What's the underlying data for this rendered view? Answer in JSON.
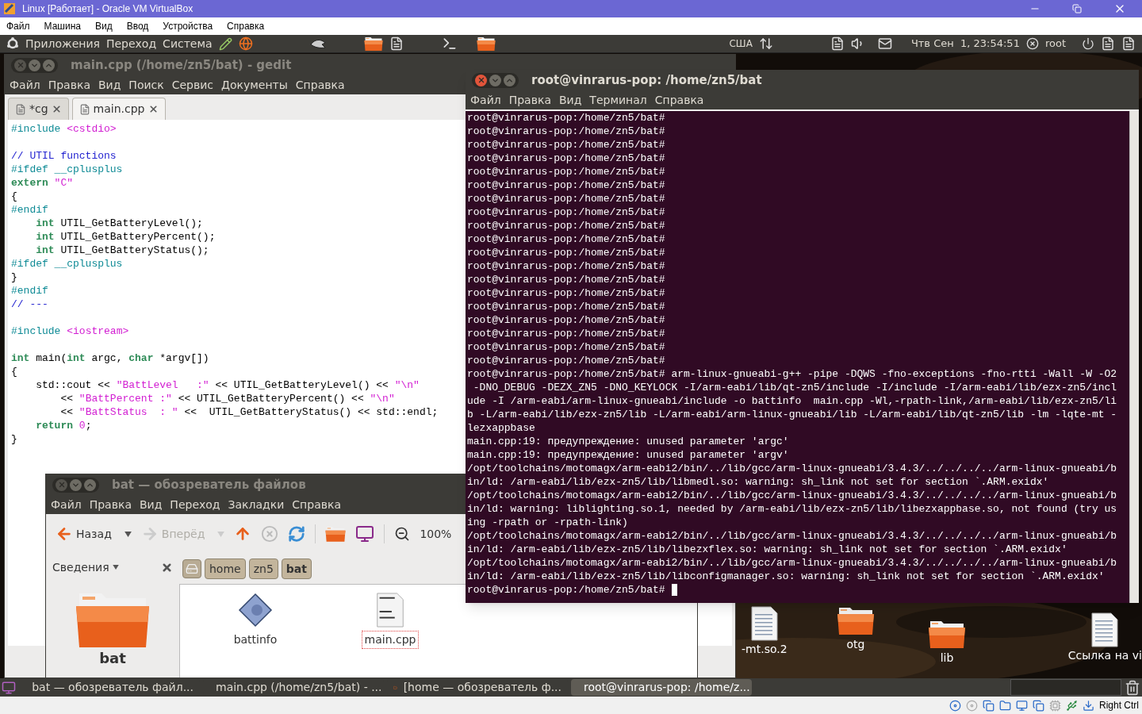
{
  "vbox": {
    "title": "Linux [Работает] - Oracle VM VirtualBox",
    "menu": [
      "Файл",
      "Машина",
      "Вид",
      "Ввод",
      "Устройства",
      "Справка"
    ],
    "host_key": "Right Ctrl"
  },
  "top_panel": {
    "menus": [
      "Приложения",
      "Переход",
      "Система"
    ],
    "keyboard": "США",
    "clock": "Чтв Сен  1, 23:54:51",
    "user": "root"
  },
  "gedit": {
    "title": "main.cpp (/home/zn5/bat) - gedit",
    "menu": [
      "Файл",
      "Правка",
      "Вид",
      "Поиск",
      "Сервис",
      "Документы",
      "Справка"
    ],
    "tabs": [
      {
        "label": "*cg",
        "selected": false
      },
      {
        "label": "main.cpp",
        "selected": true
      }
    ],
    "lines": [
      {
        "kind": "code",
        "segments": [
          {
            "kind": "preproc",
            "text": "#include"
          },
          {
            "kind": "string",
            "text": " <cstdio>"
          }
        ]
      },
      {
        "kind": "blank"
      },
      {
        "kind": "code",
        "segments": [
          {
            "kind": "comment",
            "text": "// UTIL functions"
          }
        ]
      },
      {
        "kind": "code",
        "segments": [
          {
            "kind": "preproc",
            "text": "#ifdef __cplusplus"
          }
        ]
      },
      {
        "kind": "code",
        "segments": [
          {
            "kind": "keyword",
            "text": "extern"
          },
          {
            "kind": "string",
            "text": " \"C\""
          }
        ]
      },
      {
        "kind": "code",
        "segments": [
          {
            "kind": "plain",
            "text": "{"
          }
        ]
      },
      {
        "kind": "code",
        "segments": [
          {
            "kind": "preproc",
            "text": "#endif"
          }
        ]
      },
      {
        "kind": "code",
        "segments": [
          {
            "kind": "keyword",
            "text": "    int"
          },
          {
            "kind": "plain",
            "text": " UTIL_GetBatteryLevel();"
          }
        ]
      },
      {
        "kind": "code",
        "segments": [
          {
            "kind": "keyword",
            "text": "    int"
          },
          {
            "kind": "plain",
            "text": " UTIL_GetBatteryPercent();"
          }
        ]
      },
      {
        "kind": "code",
        "segments": [
          {
            "kind": "keyword",
            "text": "    int"
          },
          {
            "kind": "plain",
            "text": " UTIL_GetBatteryStatus();"
          }
        ]
      },
      {
        "kind": "code",
        "segments": [
          {
            "kind": "preproc",
            "text": "#ifdef __cplusplus"
          }
        ]
      },
      {
        "kind": "code",
        "segments": [
          {
            "kind": "plain",
            "text": "}"
          }
        ]
      },
      {
        "kind": "code",
        "segments": [
          {
            "kind": "preproc",
            "text": "#endif"
          }
        ]
      },
      {
        "kind": "code",
        "segments": [
          {
            "kind": "comment",
            "text": "// ---"
          }
        ]
      },
      {
        "kind": "blank"
      },
      {
        "kind": "code",
        "segments": [
          {
            "kind": "preproc",
            "text": "#include"
          },
          {
            "kind": "string",
            "text": " <iostream>"
          }
        ]
      },
      {
        "kind": "blank"
      },
      {
        "kind": "code",
        "segments": [
          {
            "kind": "keyword",
            "text": "int"
          },
          {
            "kind": "plain",
            "text": " main("
          },
          {
            "kind": "keyword",
            "text": "int"
          },
          {
            "kind": "plain",
            "text": " argc, "
          },
          {
            "kind": "keyword",
            "text": "char"
          },
          {
            "kind": "plain",
            "text": " *argv[])"
          }
        ]
      },
      {
        "kind": "code",
        "segments": [
          {
            "kind": "plain",
            "text": "{"
          }
        ]
      },
      {
        "kind": "code",
        "segments": [
          {
            "kind": "plain",
            "text": "    std::cout << "
          },
          {
            "kind": "string",
            "text": "\"BattLevel   :\""
          },
          {
            "kind": "plain",
            "text": " << UTIL_GetBatteryLevel() << "
          },
          {
            "kind": "string",
            "text": "\"\\n\""
          }
        ]
      },
      {
        "kind": "code",
        "segments": [
          {
            "kind": "plain",
            "text": "        << "
          },
          {
            "kind": "string",
            "text": "\"BattPercent :\""
          },
          {
            "kind": "plain",
            "text": " << UTIL_GetBatteryPercent() << "
          },
          {
            "kind": "string",
            "text": "\"\\n\""
          }
        ]
      },
      {
        "kind": "code",
        "segments": [
          {
            "kind": "plain",
            "text": "        << "
          },
          {
            "kind": "string",
            "text": "\"BattStatus  : \""
          },
          {
            "kind": "plain",
            "text": " <<  UTIL_GetBatteryStatus() << std::endl;"
          }
        ]
      },
      {
        "kind": "code",
        "segments": [
          {
            "kind": "keyword",
            "text": "    return"
          },
          {
            "kind": "number",
            "text": " 0"
          },
          {
            "kind": "plain",
            "text": ";"
          }
        ]
      },
      {
        "kind": "code",
        "segments": [
          {
            "kind": "plain",
            "text": "}"
          }
        ]
      }
    ]
  },
  "terminal": {
    "title": "root@vinrarus-pop: /home/zn5/bat",
    "menu": [
      "Файл",
      "Правка",
      "Вид",
      "Терминал",
      "Справка"
    ],
    "cursor": true,
    "lines": [
      "root@vinrarus-pop:/home/zn5/bat#",
      "root@vinrarus-pop:/home/zn5/bat#",
      "root@vinrarus-pop:/home/zn5/bat#",
      "root@vinrarus-pop:/home/zn5/bat#",
      "root@vinrarus-pop:/home/zn5/bat#",
      "root@vinrarus-pop:/home/zn5/bat#",
      "root@vinrarus-pop:/home/zn5/bat#",
      "root@vinrarus-pop:/home/zn5/bat#",
      "root@vinrarus-pop:/home/zn5/bat#",
      "root@vinrarus-pop:/home/zn5/bat#",
      "root@vinrarus-pop:/home/zn5/bat#",
      "root@vinrarus-pop:/home/zn5/bat#",
      "root@vinrarus-pop:/home/zn5/bat#",
      "root@vinrarus-pop:/home/zn5/bat#",
      "root@vinrarus-pop:/home/zn5/bat#",
      "root@vinrarus-pop:/home/zn5/bat#",
      "root@vinrarus-pop:/home/zn5/bat#",
      "root@vinrarus-pop:/home/zn5/bat#",
      "root@vinrarus-pop:/home/zn5/bat#",
      "root@vinrarus-pop:/home/zn5/bat# arm-linux-gnueabi-g++ -pipe -DQWS -fno-exceptions -fno-rtti -Wall -W -O2",
      " -DNO_DEBUG -DEZX_ZN5 -DNO_KEYLOCK -I/arm-eabi/lib/qt-zn5/include -I/include -I/arm-eabi/lib/ezx-zn5/incl",
      "ude -I /arm-eabi/arm-linux-gnueabi/include -o battinfo  main.cpp -Wl,-rpath-link,/arm-eabi/lib/ezx-zn5/li",
      "b -L/arm-eabi/lib/ezx-zn5/lib -L/arm-eabi/arm-linux-gnueabi/lib -L/arm-eabi/lib/qt-zn5/lib -lm -lqte-mt -",
      "lezxappbase",
      "main.cpp:19: предупреждение: unused parameter 'argc'",
      "main.cpp:19: предупреждение: unused parameter 'argv'",
      "/opt/toolchains/motomagx/arm-eabi2/bin/../lib/gcc/arm-linux-gnueabi/3.4.3/../../../../arm-linux-gnueabi/b",
      "in/ld: /arm-eabi/lib/ezx-zn5/lib/libmedl.so: warning: sh_link not set for section `.ARM.exidx'",
      "/opt/toolchains/motomagx/arm-eabi2/bin/../lib/gcc/arm-linux-gnueabi/3.4.3/../../../../arm-linux-gnueabi/b",
      "in/ld: warning: liblighting.so.1, needed by /arm-eabi/lib/ezx-zn5/lib/libezxappbase.so, not found (try us",
      "ing -rpath or -rpath-link)",
      "/opt/toolchains/motomagx/arm-eabi2/bin/../lib/gcc/arm-linux-gnueabi/3.4.3/../../../../arm-linux-gnueabi/b",
      "in/ld: /arm-eabi/lib/ezx-zn5/lib/libezxflex.so: warning: sh_link not set for section `.ARM.exidx'",
      "/opt/toolchains/motomagx/arm-eabi2/bin/../lib/gcc/arm-linux-gnueabi/3.4.3/../../../../arm-linux-gnueabi/b",
      "in/ld: /arm-eabi/lib/ezx-zn5/lib/libconfigmanager.so: warning: sh_link not set for section `.ARM.exidx'",
      "root@vinrarus-pop:/home/zn5/bat#"
    ]
  },
  "file_manager": {
    "title": "bat — обозреватель файлов",
    "menu": [
      "Файл",
      "Правка",
      "Вид",
      "Переход",
      "Закладки",
      "Справка"
    ],
    "nav": [
      {
        "label": "Назад",
        "disabled": false
      },
      {
        "label": "Вперёд",
        "disabled": true
      }
    ],
    "zoom": "100%",
    "sidebar": {
      "title": "Сведения",
      "folder": "bat"
    },
    "path": [
      {
        "label": "home",
        "selected": false
      },
      {
        "label": "zn5",
        "selected": false
      },
      {
        "label": "bat",
        "selected": true
      }
    ],
    "files": [
      {
        "name": "battinfo",
        "kind": "executable",
        "selected": false
      },
      {
        "name": "main.cpp",
        "kind": "source",
        "selected": true
      }
    ]
  },
  "desktop_icons": [
    {
      "label": "-mt.so.2",
      "kind": "document"
    },
    {
      "label": "otg",
      "kind": "folder"
    },
    {
      "label": "lib",
      "kind": "folder"
    },
    {
      "label": "Ссылка на vi",
      "kind": "document"
    }
  ],
  "taskbar": [
    {
      "label": "bat — обозреватель файл...",
      "kind": "files",
      "selected": false
    },
    {
      "label": "main.cpp (/home/zn5/bat) - ...",
      "kind": "editor",
      "selected": false
    },
    {
      "label": "[home — обозреватель ф...",
      "kind": "files",
      "selected": false
    },
    {
      "label": "root@vinrarus-pop: /home/z...",
      "kind": "terminal",
      "selected": true
    }
  ]
}
